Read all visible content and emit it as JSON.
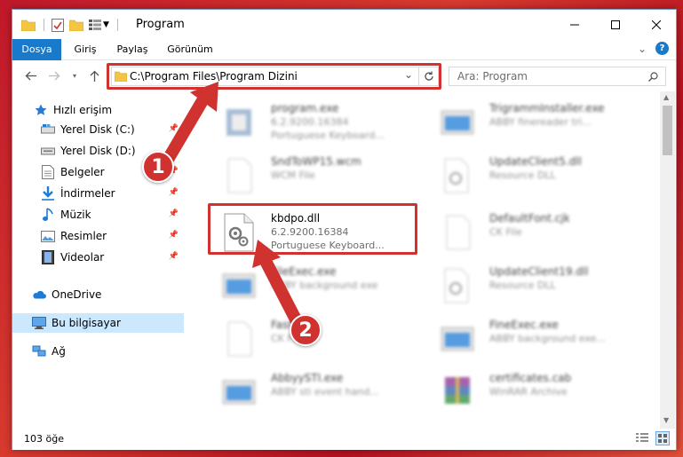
{
  "window": {
    "title": "Program"
  },
  "ribbon": {
    "tabs": [
      "Dosya",
      "Giriş",
      "Paylaş",
      "Görünüm"
    ]
  },
  "address": {
    "path": "C:\\Program Files\\Program Dizini"
  },
  "search": {
    "placeholder": "Ara: Program"
  },
  "navpane": {
    "quick_access": "Hızlı erişim",
    "items": [
      {
        "label": "Yerel Disk (C:)",
        "icon": "drive-icon"
      },
      {
        "label": "Yerel Disk (D:)",
        "icon": "drive-icon"
      },
      {
        "label": "Belgeler",
        "icon": "documents-icon"
      },
      {
        "label": "İndirmeler",
        "icon": "downloads-icon"
      },
      {
        "label": "Müzik",
        "icon": "music-icon"
      },
      {
        "label": "Resimler",
        "icon": "pictures-icon"
      },
      {
        "label": "Videolar",
        "icon": "videos-icon"
      }
    ],
    "onedrive": "OneDrive",
    "this_pc": "Bu bilgisayar",
    "network": "Ağ"
  },
  "files": {
    "left": [
      {
        "name": "program.exe",
        "line1": "6.2.9200.16384",
        "line2": "Portuguese Keyboard..."
      },
      {
        "name": "SndToWP15.wcm",
        "line1": "WCM File",
        "line2": ""
      },
      {
        "name": "kbdpo.dll",
        "line1": "6.2.9200.16384",
        "line2": "Portuguese Keyboard..."
      },
      {
        "name": "FileExec.exe",
        "line1": "ABBY background exe",
        "line2": ""
      },
      {
        "name": "FastNew",
        "line1": "CK File",
        "line2": ""
      },
      {
        "name": "AbbyySTI.exe",
        "line1": "ABBY sti event hand...",
        "line2": ""
      }
    ],
    "right": [
      {
        "name": "TrigrammInstaller.exe",
        "line1": "ABBY finereader tri...",
        "line2": ""
      },
      {
        "name": "UpdateClient5.dll",
        "line1": "Resource DLL",
        "line2": ""
      },
      {
        "name": "DefaultFont.cjk",
        "line1": "CK File",
        "line2": ""
      },
      {
        "name": "UpdateClient19.dll",
        "line1": "Resource DLL",
        "line2": ""
      },
      {
        "name": "FineExec.exe",
        "line1": "ABBY background exe...",
        "line2": ""
      },
      {
        "name": "certificates.cab",
        "line1": "WinRAR Archive",
        "line2": ""
      }
    ]
  },
  "status": {
    "count": "103 öğe"
  },
  "callouts": [
    "1",
    "2"
  ],
  "colors": {
    "accent": "#1979ca",
    "highlight": "#d0332f",
    "selected": "#cce8ff"
  }
}
